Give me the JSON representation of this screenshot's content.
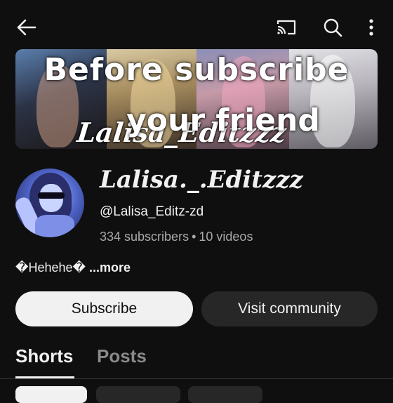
{
  "topbar": {
    "back_icon": "arrow-left-icon",
    "cast_icon": "cast-icon",
    "search_icon": "search-icon",
    "more_icon": "more-vertical-icon"
  },
  "banner": {
    "line1": "Before subscribe",
    "line2": "your friend",
    "signature": "Lalisa_Editzzz"
  },
  "channel": {
    "name": "Lalisa._.Editzzz",
    "handle": "@Lalisa_Editz-zd",
    "subscribers": "334 subscribers",
    "separator": "•",
    "videos": "10 videos",
    "description": "�Hehehe�",
    "more_label": "...more"
  },
  "buttons": {
    "subscribe_label": "Subscribe",
    "community_label": "Visit community"
  },
  "tabs": [
    {
      "label": "Shorts",
      "selected": true
    },
    {
      "label": "Posts",
      "selected": false
    }
  ],
  "colors": {
    "background": "#0f0f0f",
    "text": "#f1f1f1",
    "muted": "#aaaaaa",
    "secondary_button": "#272727"
  }
}
